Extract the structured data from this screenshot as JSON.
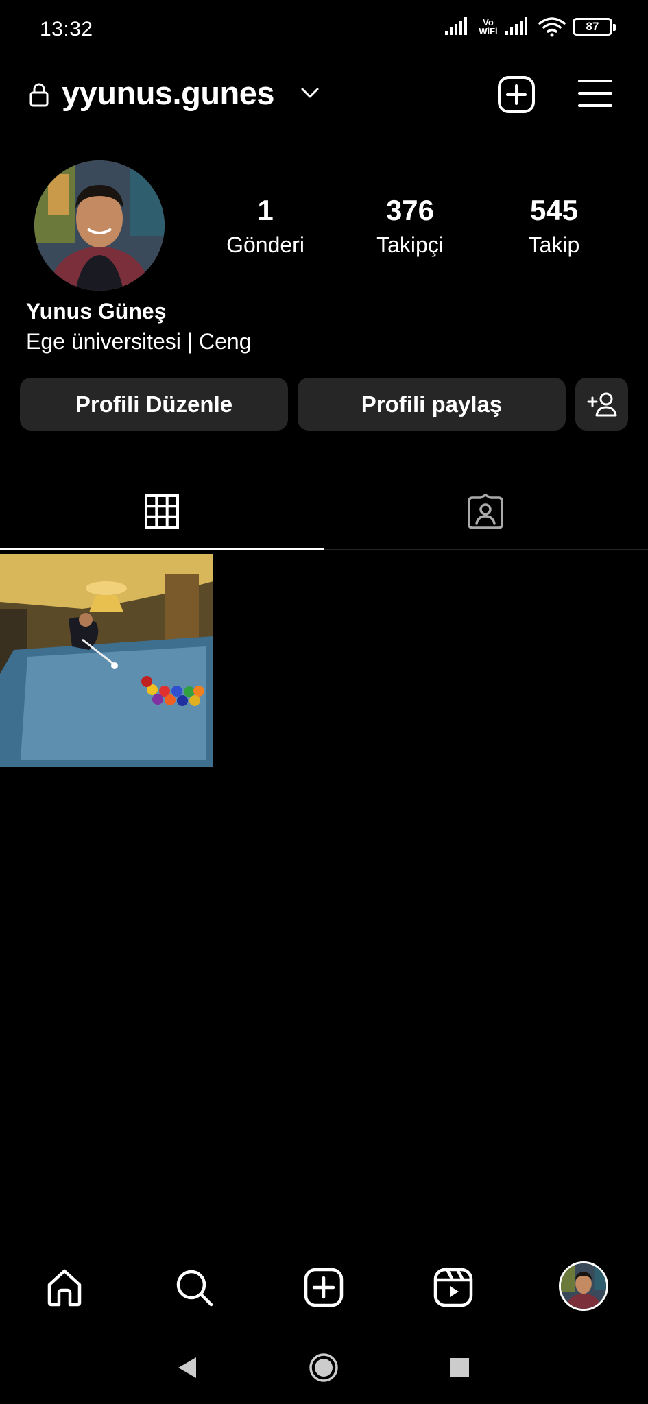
{
  "status_bar": {
    "time": "13:32",
    "vowifi_top": "Vo",
    "vowifi_bottom": "WiFi",
    "battery": "87",
    "icons": [
      "signal-icon",
      "vowifi-icon",
      "signal-icon",
      "wifi-icon",
      "battery-icon"
    ]
  },
  "header": {
    "username": "yyunus.gunes",
    "icons": [
      "lock-icon",
      "chevron-down-icon",
      "new-post-icon",
      "menu-icon"
    ]
  },
  "profile": {
    "stats": [
      {
        "value": "1",
        "label": "Gönderi"
      },
      {
        "value": "376",
        "label": "Takipçi"
      },
      {
        "value": "545",
        "label": "Takip"
      }
    ],
    "display_name": "Yunus Güneş",
    "bio": "Ege üniversitesi | Ceng"
  },
  "actions": {
    "edit_profile": "Profili Düzenle",
    "share_profile": "Profili paylaş",
    "discover_people_icon": "add-person-icon"
  },
  "tabs": [
    {
      "icon": "grid-icon",
      "active": true
    },
    {
      "icon": "tagged-person-icon",
      "active": false
    }
  ],
  "bottom_nav": {
    "items": [
      "home-icon",
      "search-icon",
      "create-icon",
      "reels-icon",
      "profile-avatar"
    ]
  },
  "system_nav": {
    "items": [
      "back-icon",
      "home-circle-icon",
      "recents-icon"
    ]
  },
  "colors": {
    "background": "#000000",
    "button": "#262626",
    "text": "#ffffff"
  }
}
